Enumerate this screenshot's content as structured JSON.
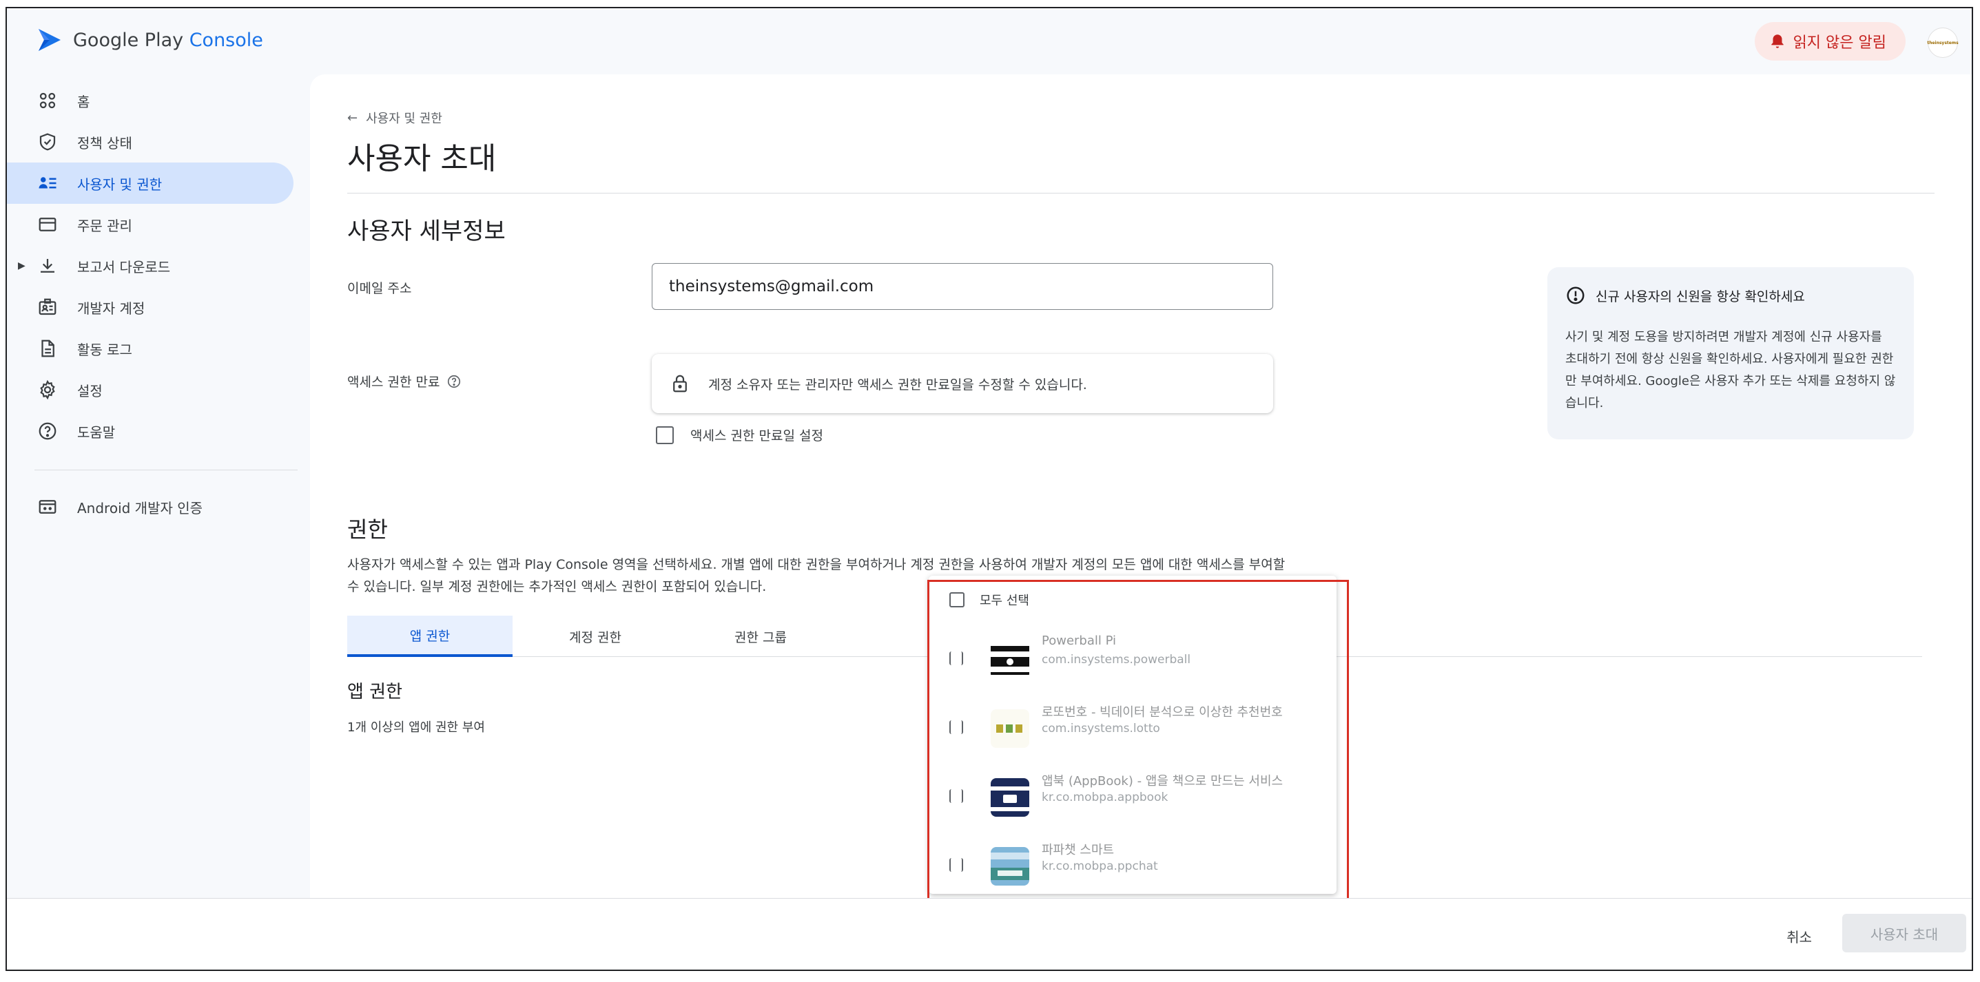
{
  "brand": {
    "name_prefix": "Google Play",
    "name_suffix": "Console"
  },
  "header": {
    "alert_label": "읽지 않은 알림",
    "avatar_text": "theinsystems"
  },
  "sidebar": {
    "items": [
      {
        "label": "홈"
      },
      {
        "label": "정책 상태"
      },
      {
        "label": "사용자 및 권한"
      },
      {
        "label": "주문 관리"
      },
      {
        "label": "보고서 다운로드"
      },
      {
        "label": "개발자 계정"
      },
      {
        "label": "활동 로그"
      },
      {
        "label": "설정"
      },
      {
        "label": "도움말"
      },
      {
        "label": "Android 개발자 인증"
      }
    ]
  },
  "main": {
    "back_label": "사용자 및 권한",
    "title": "사용자 초대",
    "details_title": "사용자 세부정보",
    "email_label": "이메일 주소",
    "email_value": "theinsystems@gmail.com",
    "expiry_label": "액세스 권한 만료",
    "expiry_notice": "계정 소유자 또는 관리자만 액세스 권한 만료일을 수정할 수 있습니다.",
    "expiry_checkbox": "액세스 권한 만료일 설정",
    "info": {
      "title": "신규 사용자의 신원을 항상 확인하세요",
      "body": "사기 및 계정 도용을 방지하려면 개발자 계정에 신규 사용자를 초대하기 전에 항상 신원을 확인하세요. 사용자에게 필요한 권한만 부여하세요. Google은 사용자 추가 또는 삭제를 요청하지 않습니다."
    },
    "permissions_title": "권한",
    "permissions_desc": "사용자가 액세스할 수 있는 앱과 Play Console 영역을 선택하세요. 개별 앱에 대한 권한을 부여하거나 계정 권한을 사용하여 개발자 계정의 모든 앱에 대한 액세스를 부여할 수 있습니다. 일부 계정 권한에는 추가적인 액세스 권한이 포함되어 있습니다.",
    "tabs": [
      {
        "label": "앱 권한"
      },
      {
        "label": "계정 권한"
      },
      {
        "label": "권한 그룹"
      }
    ],
    "app_perm_title": "앱 권한",
    "app_perm_desc": "1개 이상의 앱에 권한 부여"
  },
  "app_popup": {
    "select_all": "모두 선택",
    "apps": [
      {
        "name": "Powerball Pi",
        "package": "com.insystems.powerball"
      },
      {
        "name": "로또번호 - 빅데이터 분석으로 이상한 추천번호",
        "package": "com.insystems.lotto"
      },
      {
        "name": "앱북 (AppBook) - 앱을 책으로 만드는 서비스",
        "package": "kr.co.mobpa.appbook"
      },
      {
        "name": "파파챗 스마트",
        "package": "kr.co.mobpa.ppchat"
      }
    ]
  },
  "footer": {
    "cancel": "취소",
    "invite": "사용자 초대"
  },
  "colors": {
    "accent": "#0b57d0",
    "active_nav": "#d3e3fd",
    "highlight": "#d93025",
    "alert_bg": "#fce8e6"
  }
}
